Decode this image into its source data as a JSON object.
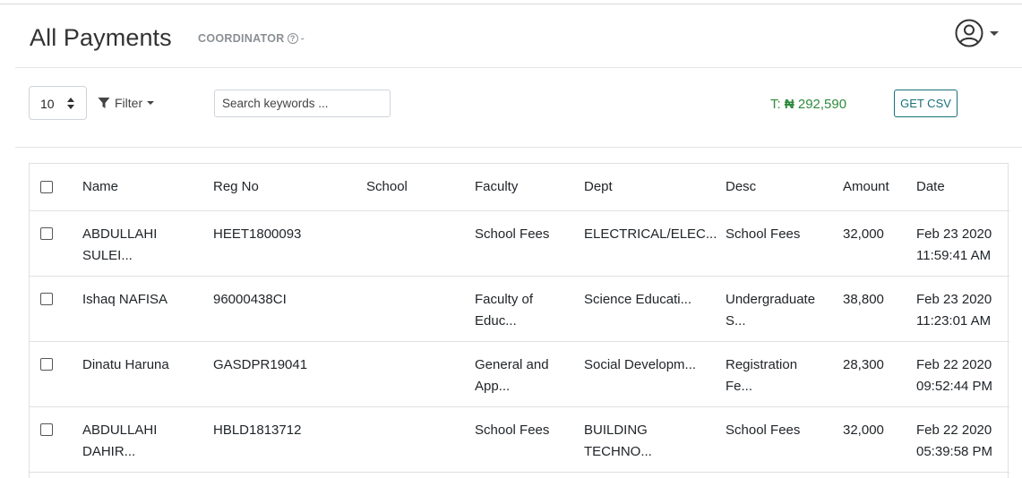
{
  "header": {
    "title": "All Payments",
    "role_label": "COORDINATOR",
    "role_suffix": "-",
    "user_icon": "user-circle-icon"
  },
  "toolbar": {
    "page_size": "10",
    "filter_label": "Filter",
    "search_placeholder": "Search keywords ...",
    "total_prefix": "T:",
    "total_currency": "₦",
    "total_amount": "292,590",
    "csv_label": "GET CSV"
  },
  "table": {
    "columns": [
      "Name",
      "Reg No",
      "School",
      "Faculty",
      "Dept",
      "Desc",
      "Amount",
      "Date"
    ],
    "rows": [
      {
        "name": "ABDULLAHI\nSULEI...",
        "reg_no": "HEET1800093",
        "school": "",
        "faculty": "School Fees",
        "dept": "ELECTRICAL/ELEC...",
        "desc": "School Fees",
        "amount": "32,000",
        "date": "Feb 23 2020\n11:59:41 AM"
      },
      {
        "name": "Ishaq NAFISA",
        "reg_no": "96000438CI",
        "school": "",
        "faculty": "Faculty of\nEduc...",
        "dept": "Science Educati...",
        "desc": "Undergraduate\nS...",
        "amount": "38,800",
        "date": "Feb 23 2020\n11:23:01 AM"
      },
      {
        "name": "Dinatu Haruna",
        "reg_no": "GASDPR19041",
        "school": "",
        "faculty": "General and\nApp...",
        "dept": "Social Developm...",
        "desc": "Registration\nFe...",
        "amount": "28,300",
        "date": "Feb 22 2020\n09:52:44 PM"
      },
      {
        "name": "ABDULLAHI\nDAHIR...",
        "reg_no": "HBLD1813712",
        "school": "",
        "faculty": "School Fees",
        "dept": "BUILDING\nTECHNO...",
        "desc": "School Fees",
        "amount": "32,000",
        "date": "Feb 22 2020\n05:39:58 PM"
      }
    ]
  },
  "colors": {
    "accent": "#17707a",
    "total_text": "#2e8b3d",
    "muted": "#8a8f94"
  }
}
